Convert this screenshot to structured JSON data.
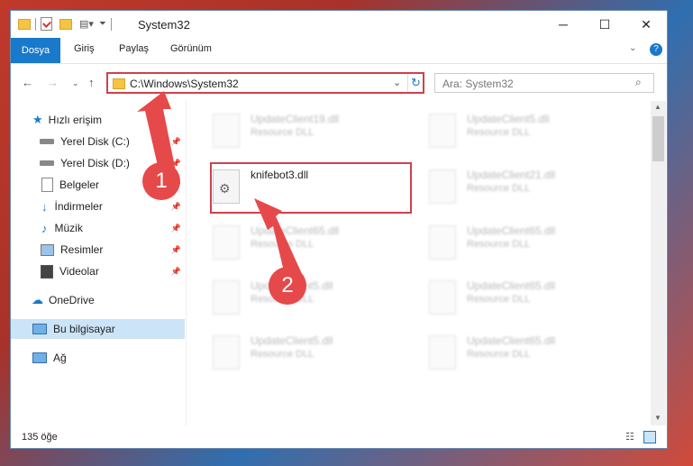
{
  "window": {
    "title": "System32"
  },
  "ribbon": {
    "tabs": [
      "Dosya",
      "Giriş",
      "Paylaş",
      "Görünüm"
    ]
  },
  "address": {
    "path": "C:\\Windows\\System32"
  },
  "search": {
    "placeholder": "Ara: System32"
  },
  "sidebar": {
    "items": [
      "Hızlı erişim",
      "Yerel Disk (C:)",
      "Yerel Disk (D:)",
      "Belgeler",
      "İndirmeler",
      "Müzik",
      "Resimler",
      "Videolar",
      "OneDrive",
      "Bu bilgisayar",
      "Ağ"
    ]
  },
  "files": {
    "highlighted": {
      "name": "knifebot3.dll"
    },
    "left": [
      {
        "name": "UpdateClient19.dll",
        "desc": "Resource DLL"
      },
      {
        "name": "UpdateClient65.dll",
        "desc": "Resource DLL"
      },
      {
        "name": "UpdateClient5.dll",
        "desc": "Resource DLL"
      },
      {
        "name": "UpdateClient5.dll",
        "desc": "Resource DLL"
      }
    ],
    "right": [
      {
        "name": "UpdateClient5.dll",
        "desc": "Resource DLL"
      },
      {
        "name": "UpdateClient21.dll",
        "desc": "Resource DLL"
      },
      {
        "name": "UpdateClient65.dll",
        "desc": "Resource DLL"
      },
      {
        "name": "UpdateClient65.dll",
        "desc": "Resource DLL"
      },
      {
        "name": "UpdateClient65.dll",
        "desc": "Resource DLL"
      }
    ]
  },
  "status": {
    "count": "135 öğe"
  },
  "annotations": {
    "step1": "1",
    "step2": "2"
  },
  "colors": {
    "accent": "#1979ca",
    "highlight": "#d0414a",
    "badge": "#e6494a"
  }
}
